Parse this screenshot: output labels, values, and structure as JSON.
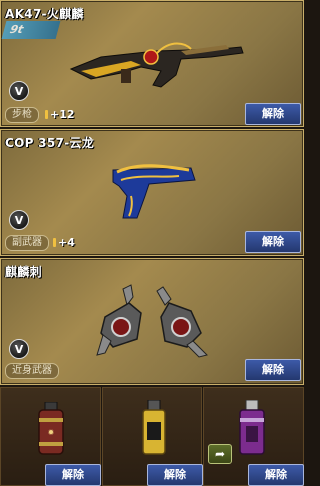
{
  "cards": [
    {
      "title": "AK47-火麒麟",
      "tag": "步枪",
      "plus": "+12",
      "button": "解除",
      "icon": "rifle-ak47-icon",
      "logo": "9t"
    },
    {
      "title": "COP 357-云龙",
      "tag": "副武器",
      "plus": "+4",
      "button": "解除",
      "icon": "pistol-icon"
    },
    {
      "title": "麒麟刺",
      "tag": "近身武器",
      "button": "解除",
      "icon": "dual-claw-icon"
    }
  ],
  "slots": [
    {
      "button": "解除",
      "icon": "grenade-red-icon"
    },
    {
      "button": "解除",
      "icon": "grenade-yellow-icon"
    },
    {
      "button": "解除",
      "icon": "grenade-purple-icon"
    }
  ],
  "v_label": "V",
  "colors": {
    "button_bg": "#2f4a90",
    "card_bg": "#a48a4e",
    "slot_bg": "#3e2e1c"
  }
}
